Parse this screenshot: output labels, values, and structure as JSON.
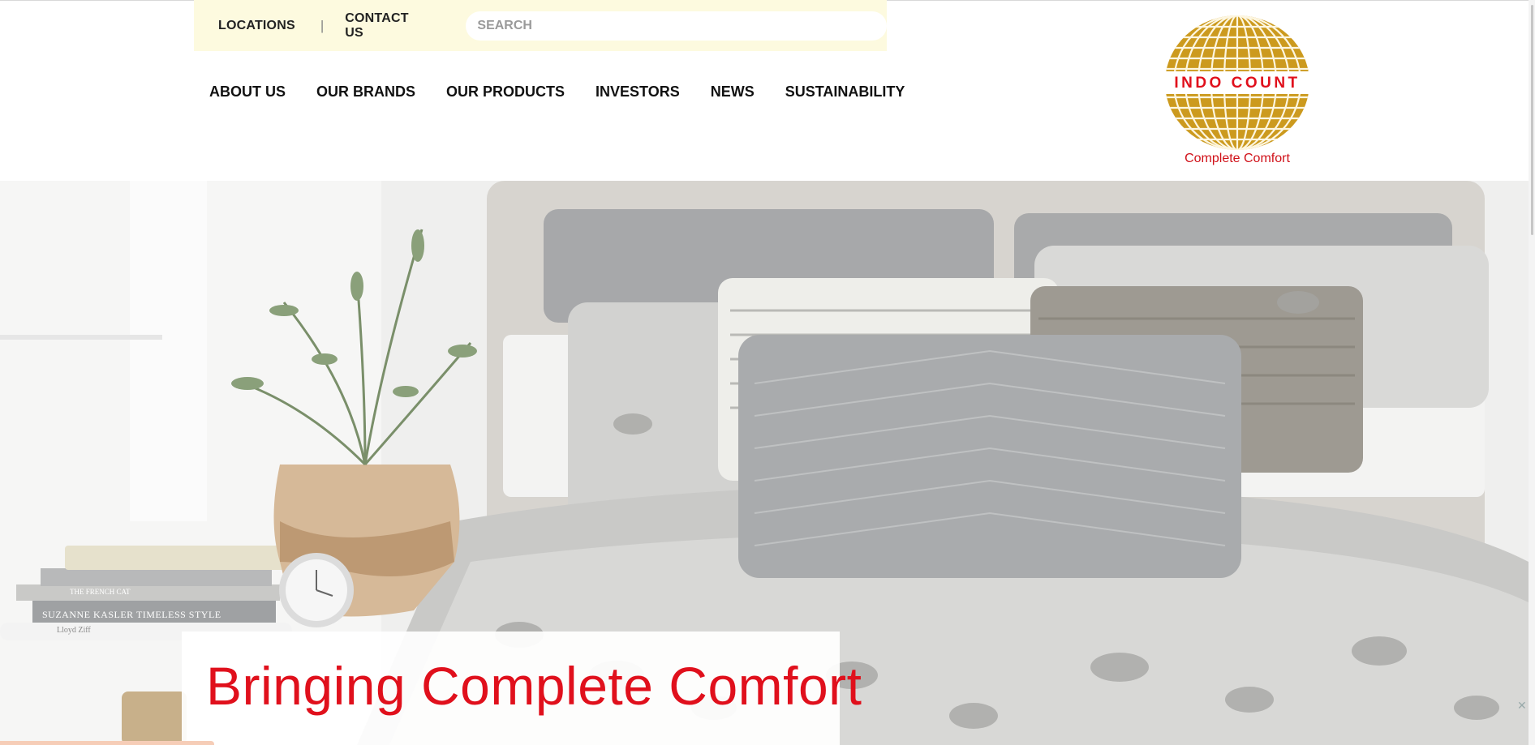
{
  "utility_bar": {
    "locations_label": "LOCATIONS",
    "separator": "|",
    "contact_label": "CONTACT US",
    "search_placeholder": "SEARCH"
  },
  "main_nav": {
    "items": [
      {
        "label": "ABOUT US"
      },
      {
        "label": "OUR BRANDS"
      },
      {
        "label": "OUR PRODUCTS"
      },
      {
        "label": "INVESTORS"
      },
      {
        "label": "NEWS"
      },
      {
        "label": "SUSTAINABILITY"
      }
    ]
  },
  "logo": {
    "brand_name": "INDO COUNT",
    "tagline": "Complete Comfort",
    "globe_color": "#cc9a1e",
    "text_color": "#e0101c"
  },
  "hero": {
    "headline": "Bringing Complete Comfort",
    "book_titles": [
      "THE FRENCH CAT",
      "SUZANNE KASLER TIMELESS STYLE",
      "Lloyd Ziff"
    ]
  },
  "colors": {
    "utility_bg": "#fdfadf",
    "accent_red": "#e0101c",
    "logo_gold": "#cc9a1e"
  }
}
